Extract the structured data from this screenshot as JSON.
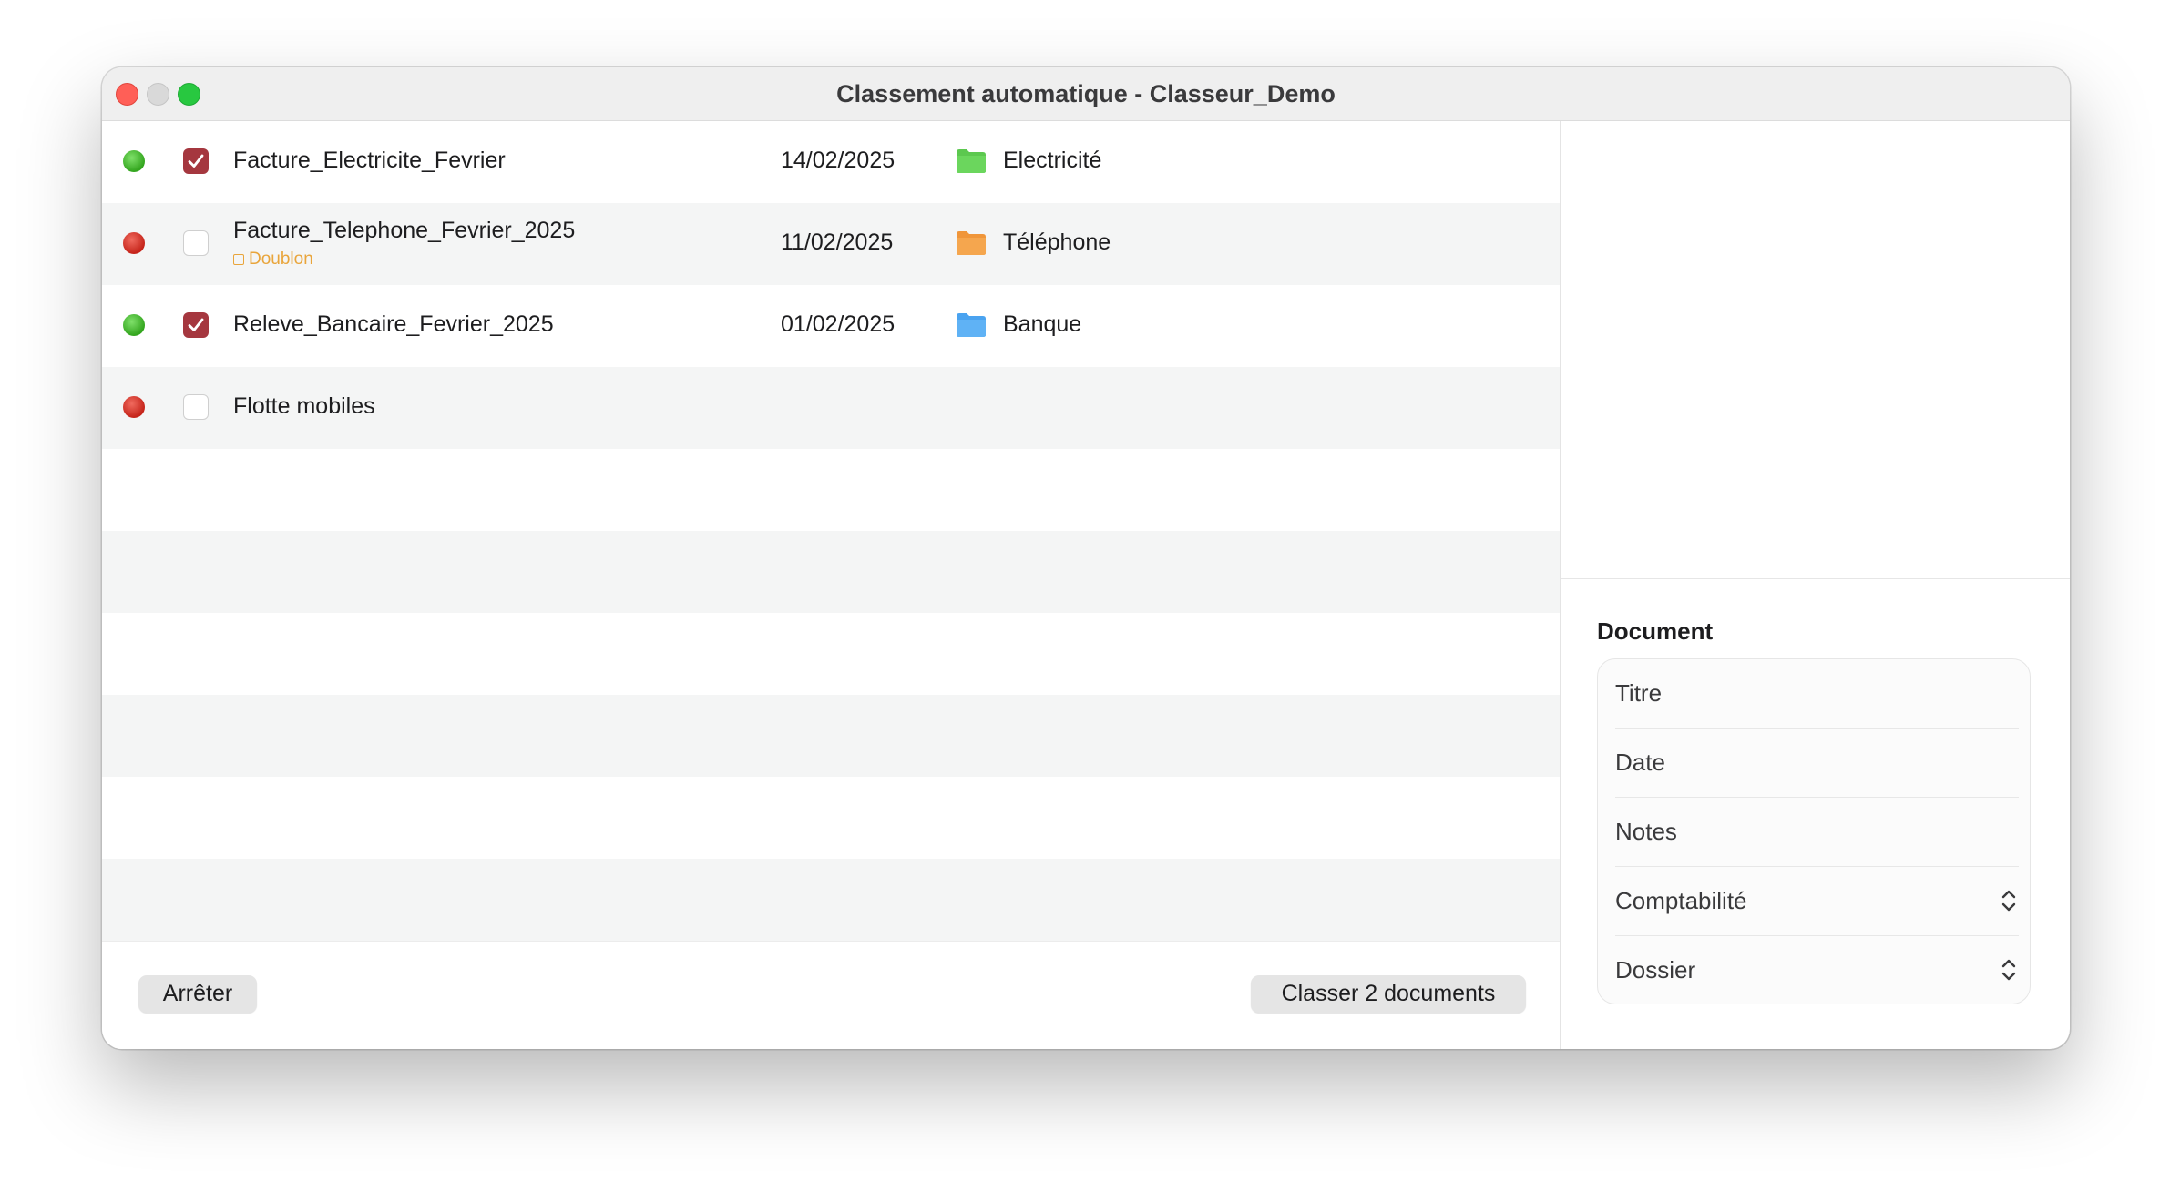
{
  "window": {
    "title": "Classement automatique - Classeur_Demo"
  },
  "rows": [
    {
      "status": "green",
      "checked": true,
      "name": "Facture_Electricite_Fevrier",
      "badge": "",
      "date": "14/02/2025",
      "folder": "Electricité",
      "folder_color": "#5cc84f"
    },
    {
      "status": "red",
      "checked": false,
      "name": "Facture_Telephone_Fevrier_2025",
      "badge": "Doublon",
      "date": "11/02/2025",
      "folder": "Téléphone",
      "folder_color": "#f0963a"
    },
    {
      "status": "green",
      "checked": true,
      "name": "Releve_Bancaire_Fevrier_2025",
      "badge": "",
      "date": "01/02/2025",
      "folder": "Banque",
      "folder_color": "#4aa3f0"
    },
    {
      "status": "red",
      "checked": false,
      "name": "Flotte mobiles",
      "badge": "",
      "date": "",
      "folder": "",
      "folder_color": ""
    }
  ],
  "footer": {
    "stop_label": "Arrêter",
    "classify_label": "Classer 2 documents"
  },
  "sidebar": {
    "section_title": "Document",
    "fields": {
      "title_label": "Titre",
      "date_label": "Date",
      "notes_label": "Notes",
      "accounting_label": "Comptabilité",
      "folder_label": "Dossier"
    }
  },
  "colors": {
    "status_green": "#33a51e",
    "status_red": "#c5241a",
    "checkbox_checked": "#a5373f",
    "duplicate_badge": "#e9a53b"
  }
}
